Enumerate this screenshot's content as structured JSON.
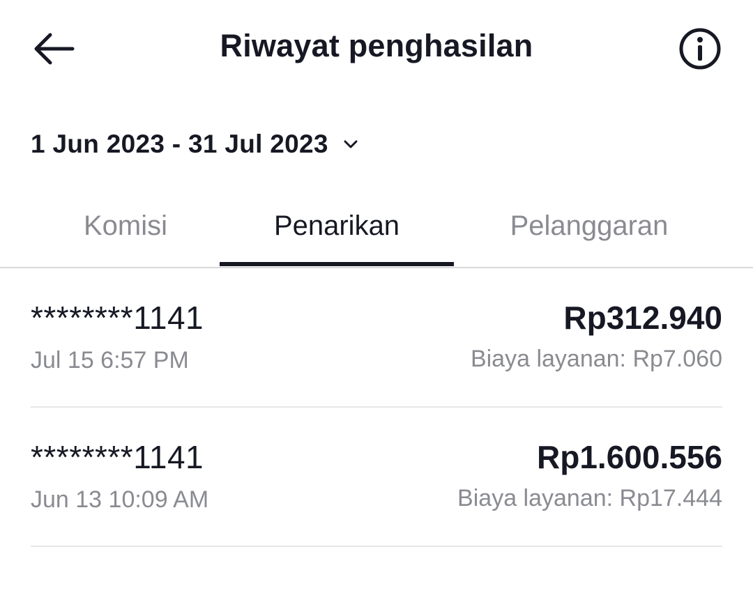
{
  "header": {
    "title": "Riwayat penghasilan",
    "back_icon": "arrow-left-icon",
    "info_icon": "info-circle-icon"
  },
  "date_filter": {
    "range": "1 Jun 2023 - 31 Jul 2023",
    "icon": "chevron-down-icon"
  },
  "tabs": [
    {
      "label": "Komisi",
      "active": false
    },
    {
      "label": "Penarikan",
      "active": true
    },
    {
      "label": "Pelanggaran",
      "active": false
    }
  ],
  "withdrawals": [
    {
      "account": "********1141",
      "datetime": "Jul 15 6:57 PM",
      "amount": "Rp312.940",
      "fee": "Biaya layanan: Rp7.060"
    },
    {
      "account": "********1141",
      "datetime": "Jun 13 10:09 AM",
      "amount": "Rp1.600.556",
      "fee": "Biaya layanan: Rp17.444"
    }
  ],
  "colors": {
    "text_primary": "#161823",
    "text_secondary": "#8a8b91",
    "divider": "#e6e6e8"
  }
}
